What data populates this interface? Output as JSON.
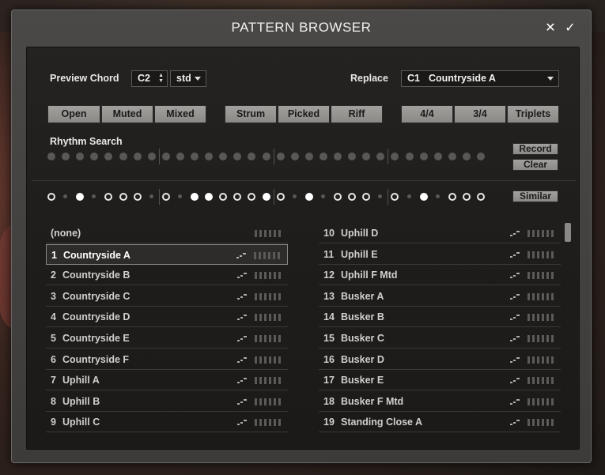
{
  "window": {
    "title": "PATTERN BROWSER",
    "close_symbol": "✕",
    "ok_symbol": "✓"
  },
  "preview_chord": {
    "label": "Preview Chord",
    "note": "C2",
    "type": "std"
  },
  "replace": {
    "label": "Replace",
    "slot": "C1",
    "value": "Countryside A"
  },
  "style_buttons": [
    "Open",
    "Muted",
    "Mixed"
  ],
  "mode_buttons": [
    "Strum",
    "Picked",
    "Riff"
  ],
  "time_buttons": [
    "4/4",
    "3/4",
    "Triplets"
  ],
  "rhythm_search": {
    "label": "Rhythm Search",
    "record": "Record",
    "clear": "Clear"
  },
  "similar_label": "Similar",
  "rhythm_pattern": [
    "o",
    "s",
    "f",
    "s",
    "o",
    "o",
    "o",
    "s",
    "o",
    "s",
    "f",
    "f",
    "o",
    "o",
    "o",
    "f",
    "o",
    "s",
    "f",
    "s",
    "o",
    "o",
    "o",
    "s",
    "o",
    "s",
    "f",
    "s",
    "o",
    "o",
    "o"
  ],
  "list_left": [
    {
      "num": "",
      "name": "(none)",
      "selected": false
    },
    {
      "num": "1",
      "name": "Countryside A",
      "selected": true
    },
    {
      "num": "2",
      "name": "Countryside B",
      "selected": false
    },
    {
      "num": "3",
      "name": "Countryside C",
      "selected": false
    },
    {
      "num": "4",
      "name": "Countryside D",
      "selected": false
    },
    {
      "num": "5",
      "name": "Countryside E",
      "selected": false
    },
    {
      "num": "6",
      "name": "Countryside F",
      "selected": false
    },
    {
      "num": "7",
      "name": "Uphill A",
      "selected": false
    },
    {
      "num": "8",
      "name": "Uphill B",
      "selected": false
    },
    {
      "num": "9",
      "name": "Uphill C",
      "selected": false
    }
  ],
  "list_right": [
    {
      "num": "10",
      "name": "Uphill D"
    },
    {
      "num": "11",
      "name": "Uphill E"
    },
    {
      "num": "12",
      "name": "Uphill F Mtd"
    },
    {
      "num": "13",
      "name": "Busker A"
    },
    {
      "num": "14",
      "name": "Busker B"
    },
    {
      "num": "15",
      "name": "Busker C"
    },
    {
      "num": "16",
      "name": "Busker D"
    },
    {
      "num": "17",
      "name": "Busker E"
    },
    {
      "num": "18",
      "name": "Busker F Mtd"
    },
    {
      "num": "19",
      "name": "Standing Close A"
    }
  ]
}
